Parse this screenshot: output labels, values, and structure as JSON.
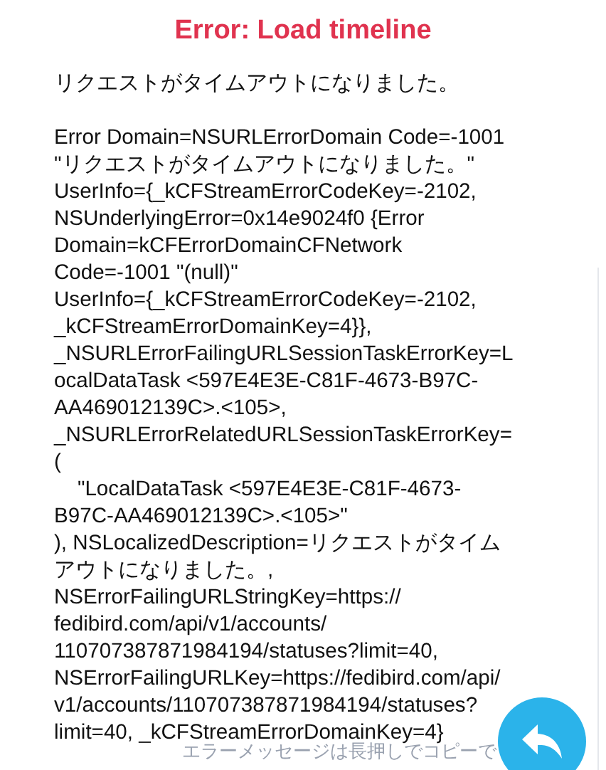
{
  "title": "Error: Load timeline",
  "message": "リクエストがタイムアウトになりました。\n\nError Domain=NSURLErrorDomain Code=-1001\n\"リクエストがタイムアウトになりました。\"\nUserInfo={_kCFStreamErrorCodeKey=-2102,\nNSUnderlyingError=0x14e9024f0 {Error\nDomain=kCFErrorDomainCFNetwork\nCode=-1001 \"(null)\"\nUserInfo={_kCFStreamErrorCodeKey=-2102,\n_kCFStreamErrorDomainKey=4}},\n_NSURLErrorFailingURLSessionTaskErrorKey=L\nocalDataTask <597E4E3E-C81F-4673-B97C-\nAA469012139C>.<105>,\n_NSURLErrorRelatedURLSessionTaskErrorKey=(\n    \"LocalDataTask <597E4E3E-C81F-4673-\nB97C-AA469012139C>.<105>\"\n), NSLocalizedDescription=リクエストがタイムアウトになりました。,\nNSErrorFailingURLStringKey=https://\nfedibird.com/api/v1/accounts/\n110707387871984194/statuses?limit=40,\nNSErrorFailingURLKey=https://fedibird.com/api/\nv1/accounts/110707387871984194/statuses?\nlimit=40, _kCFStreamErrorDomainKey=4}",
  "hint": "エラーメッセージは長押しでコピーで"
}
